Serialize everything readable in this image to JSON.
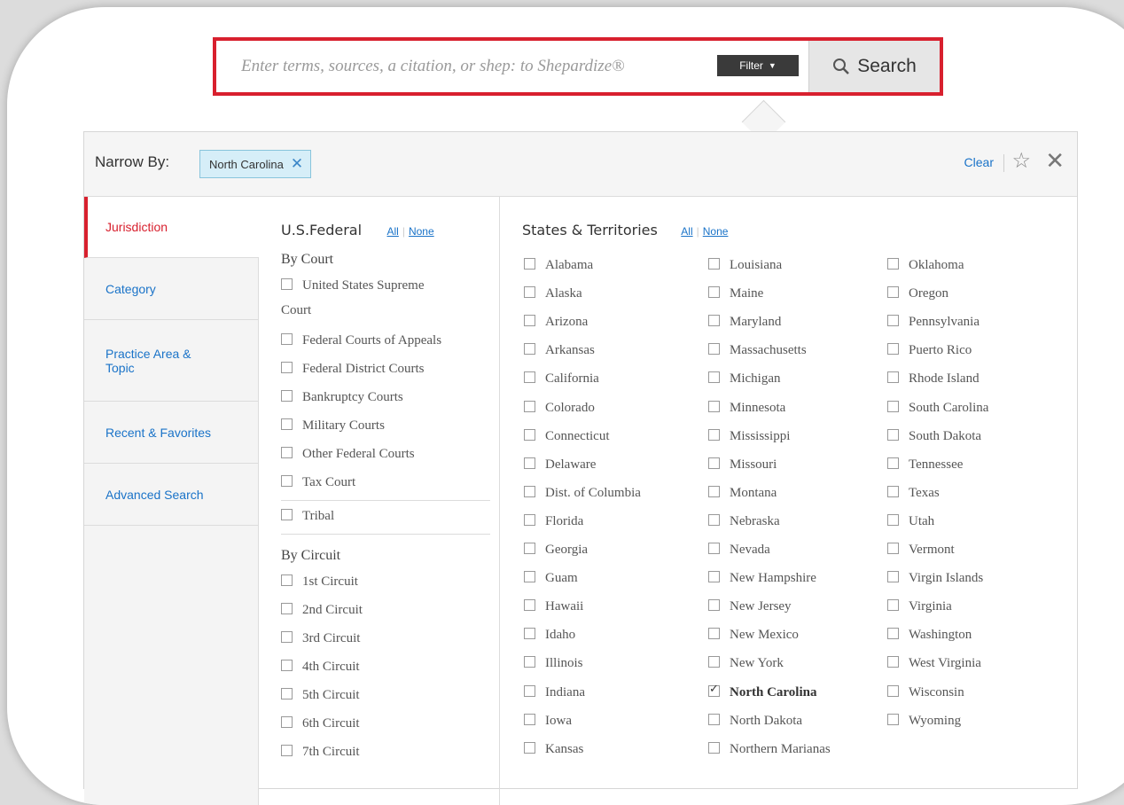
{
  "search": {
    "placeholder": "Enter terms, sources, a citation, or shep: to Shepardize®",
    "filter_label": "Filter",
    "search_label": "Search"
  },
  "narrow": {
    "label": "Narrow By:",
    "chip": "North Carolina",
    "clear": "Clear"
  },
  "sidebar": {
    "items": [
      {
        "label": "Jurisdiction"
      },
      {
        "label": "Category"
      },
      {
        "label": "Practice Area & Topic"
      },
      {
        "label": "Recent & Favorites"
      },
      {
        "label": "Advanced Search"
      }
    ]
  },
  "federal": {
    "title": "U.S.Federal",
    "all": "All",
    "none": "None",
    "by_court": "By Court",
    "courts": [
      "United States Supreme",
      "Court",
      "Federal Courts of Appeals",
      "Federal District Courts",
      "Bankruptcy Courts",
      "Military Courts",
      "Other Federal Courts",
      "Tax Court"
    ],
    "tribal": "Tribal",
    "by_circuit": "By Circuit",
    "circuits": [
      "1st Circuit",
      "2nd Circuit",
      "3rd Circuit",
      "4th Circuit",
      "5th Circuit",
      "6th Circuit",
      "7th Circuit"
    ]
  },
  "states": {
    "title": "States & Territories",
    "all": "All",
    "none": "None",
    "columns": [
      [
        "Alabama",
        "Alaska",
        "Arizona",
        "Arkansas",
        "California",
        "Colorado",
        "Connecticut",
        "Delaware",
        "Dist. of Columbia",
        "Florida",
        "Georgia",
        "Guam",
        "Hawaii",
        "Idaho",
        "Illinois",
        "Indiana",
        "Iowa",
        "Kansas"
      ],
      [
        "Louisiana",
        "Maine",
        "Maryland",
        "Massachusetts",
        "Michigan",
        "Minnesota",
        "Mississippi",
        "Missouri",
        "Montana",
        "Nebraska",
        "Nevada",
        "New Hampshire",
        "New Jersey",
        "New Mexico",
        "New York",
        "North Carolina",
        "North Dakota",
        "Northern Marianas"
      ],
      [
        "Oklahoma",
        "Oregon",
        "Pennsylvania",
        "Puerto Rico",
        "Rhode Island",
        "South Carolina",
        "South Dakota",
        "Tennessee",
        "Texas",
        "Utah",
        "Vermont",
        "Virgin Islands",
        "Virginia",
        "Washington",
        "West Virginia",
        "Wisconsin",
        "Wyoming"
      ]
    ],
    "checked": "North Carolina"
  }
}
